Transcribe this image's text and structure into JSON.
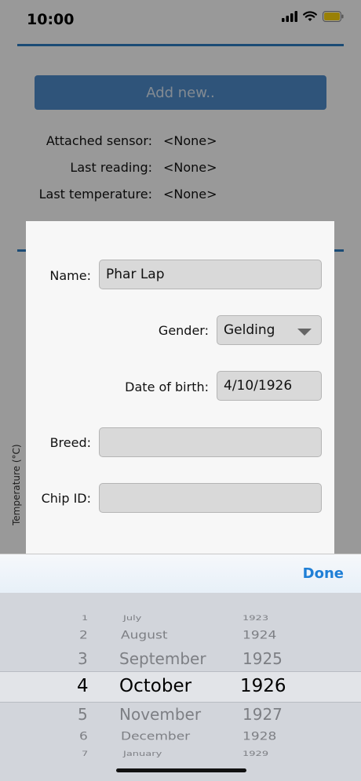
{
  "status_bar": {
    "time": "10:00",
    "signal_icon": "signal-bars-icon",
    "wifi_icon": "wifi-icon",
    "battery_icon": "battery-icon",
    "battery_color": "#ffd60a"
  },
  "background": {
    "add_button_label": "Add new..",
    "info": [
      {
        "label": "Attached sensor:",
        "value": "<None>"
      },
      {
        "label": "Last reading:",
        "value": "<None>"
      },
      {
        "label": "Last temperature:",
        "value": "<None>"
      }
    ],
    "y_axis_label": "Temperature (°C)",
    "accent_color": "#2e7ec4"
  },
  "dialog": {
    "name_label": "Name:",
    "name_value": "Phar Lap",
    "gender_label": "Gender:",
    "gender_value": "Gelding",
    "dob_label": "Date of birth:",
    "dob_value": "4/10/1926",
    "breed_label": "Breed:",
    "breed_value": "",
    "chip_label": "Chip ID:",
    "chip_value": ""
  },
  "toolbar": {
    "done_label": "Done",
    "accent_color": "#1f7fd6"
  },
  "picker": {
    "days": [
      "1",
      "2",
      "3",
      "4",
      "5",
      "6",
      "7"
    ],
    "months": [
      "July",
      "August",
      "September",
      "October",
      "November",
      "December",
      "January"
    ],
    "years": [
      "1923",
      "1924",
      "1925",
      "1926",
      "1927",
      "1928",
      "1929"
    ],
    "selected": {
      "day": "4",
      "month": "October",
      "year": "1926"
    }
  }
}
